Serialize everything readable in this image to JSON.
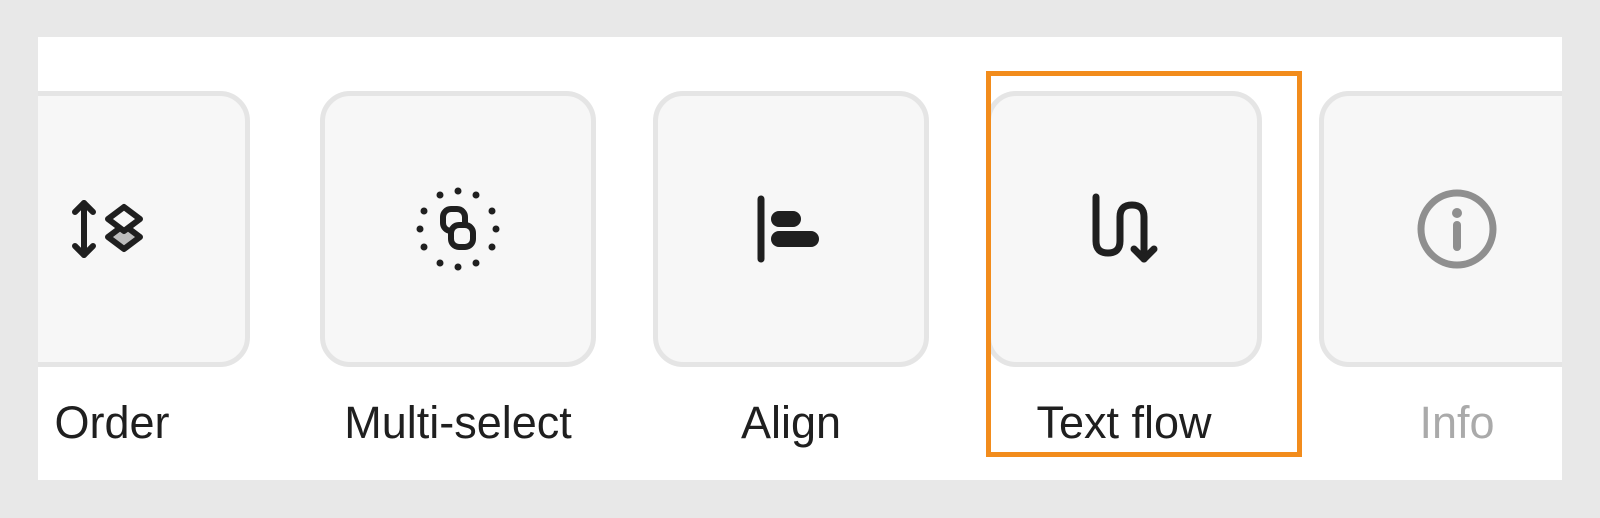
{
  "toolbar": {
    "items": [
      {
        "label": "Order",
        "icon": "order-icon",
        "enabled": true
      },
      {
        "label": "Multi-select",
        "icon": "multi-select-icon",
        "enabled": true
      },
      {
        "label": "Align",
        "icon": "align-left-icon",
        "enabled": true
      },
      {
        "label": "Text flow",
        "icon": "text-flow-icon",
        "enabled": true,
        "highlighted": true
      },
      {
        "label": "Info",
        "icon": "info-icon",
        "enabled": false
      }
    ]
  },
  "colors": {
    "background": "#e8e8e8",
    "panel": "#ffffff",
    "tile": "#f7f7f7",
    "tile_border": "#e5e5e5",
    "icon": "#1f1f1f",
    "disabled": "#aaaaaa",
    "highlight": "#f28c1c"
  }
}
